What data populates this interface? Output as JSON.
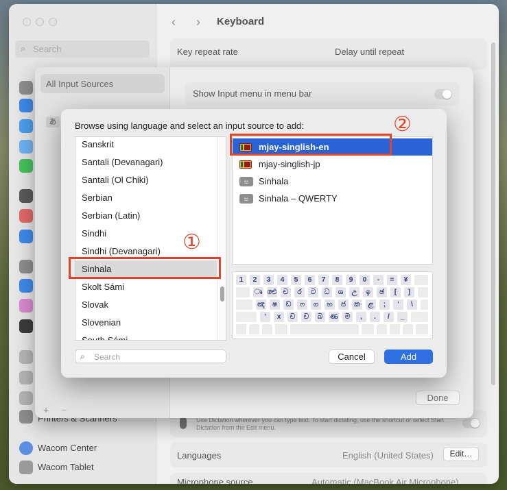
{
  "window": {
    "title": "Keyboard",
    "search_placeholder": "Search",
    "back_icon": "‹",
    "forward_icon": "›",
    "sidebar_items": [
      "Printers & Scanners",
      "Wacom Center",
      "Wacom Tablet"
    ],
    "rows": {
      "key_repeat_rate": "Key repeat rate",
      "delay_until_repeat": "Delay until repeat",
      "dictation_hint": "Use Dictation wherever you can type text. To start dictating, use the shortcut or select Start Dictation from the Edit menu.",
      "languages_label": "Languages",
      "languages_value": "English (United States)",
      "edit_button": "Edit…",
      "microphone_label": "Microphone source",
      "microphone_value": "Automatic (MacBook Air Microphone)"
    }
  },
  "sheet": {
    "all_input_sources": "All Input Sources",
    "jp_glyph": "あ",
    "show_menu_label": "Show Input menu in menu bar",
    "plus": "+",
    "minus": "−",
    "done_button": "Done"
  },
  "dialog": {
    "prompt": "Browse using language and select an input source to add:",
    "languages": [
      "Sanskrit",
      "Santali (Devanagari)",
      "Santali (Ol Chiki)",
      "Serbian",
      "Serbian (Latin)",
      "Sindhi",
      "Sindhi (Devanagari)",
      "Sinhala",
      "Skolt Sámi",
      "Slovak",
      "Slovenian",
      "South Sámi"
    ],
    "selected_language": "Sinhala",
    "input_sources": [
      {
        "label": "mjay-singlish-en",
        "icon": "sri-lanka-flag-icon",
        "selected": true
      },
      {
        "label": "mjay-singlish-jp",
        "icon": "sri-lanka-flag-icon",
        "selected": false
      },
      {
        "label": "Sinhala",
        "icon": "sinhala-script-icon",
        "selected": false
      },
      {
        "label": "Sinhala – QWERTY",
        "icon": "sinhala-script-icon",
        "selected": false
      }
    ],
    "script_glyph": "ස",
    "keyboard_rows": [
      [
        "1",
        "2",
        "3",
        "4",
        "5",
        "6",
        "7",
        "8",
        "9",
        "0",
        "-",
        "=",
        "¥"
      ],
      [
        "ෘ",
        "ඓ",
        "ච",
        "ර",
        "ට",
        "ධ",
        "ශ",
        "උ",
        "ඉ",
        "ඡ",
        "[",
        "]"
      ],
      [
        "ඤ",
        "ෂ",
        "ඩ",
        "ෆ",
        "ග",
        "හ",
        "ජ",
        "ක",
        "ළ",
        ";",
        "'",
        "\\"
      ],
      [
        "'",
        "x",
        "ච",
        "ච",
        "බ",
        "ණ",
        "ම",
        ",",
        ".",
        "/",
        "_"
      ]
    ],
    "search_placeholder": "Search",
    "cancel_button": "Cancel",
    "add_button": "Add"
  },
  "annotations": {
    "step1": "①",
    "step2": "②"
  },
  "colors": {
    "accent": "#2f6fe4",
    "selection": "#2a63d6",
    "annotation": "#e0452a"
  }
}
